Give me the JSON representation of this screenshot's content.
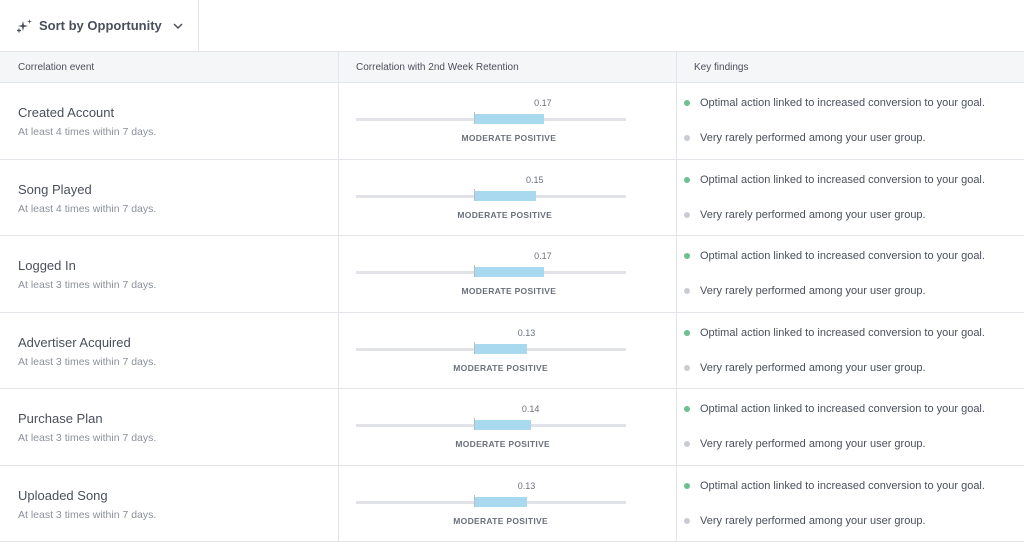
{
  "toolbar": {
    "sort_label": "Sort by Opportunity"
  },
  "table": {
    "headers": {
      "event": "Correlation event",
      "correlation": "Correlation with 2nd Week Retention",
      "findings": "Key findings"
    },
    "rows": [
      {
        "name": "Created Account",
        "subtitle": "At least 4 times within 7 days.",
        "value": 0.17,
        "value_label": "0.17",
        "category": "MODERATE POSITIVE",
        "findings": [
          {
            "text": "Optimal action linked to increased conversion to your goal.",
            "color": "#6cc08f"
          },
          {
            "text": "Very rarely performed among your user group.",
            "color": "#c9ccd2"
          }
        ]
      },
      {
        "name": "Song Played",
        "subtitle": "At least 4 times within 7 days.",
        "value": 0.15,
        "value_label": "0.15",
        "category": "MODERATE POSITIVE",
        "findings": [
          {
            "text": "Optimal action linked to increased conversion to your goal.",
            "color": "#6cc08f"
          },
          {
            "text": "Very rarely performed among your user group.",
            "color": "#c9ccd2"
          }
        ]
      },
      {
        "name": "Logged In",
        "subtitle": "At least 3 times within 7 days.",
        "value": 0.17,
        "value_label": "0.17",
        "category": "MODERATE POSITIVE",
        "findings": [
          {
            "text": "Optimal action linked to increased conversion to your goal.",
            "color": "#6cc08f"
          },
          {
            "text": "Very rarely performed among your user group.",
            "color": "#c9ccd2"
          }
        ]
      },
      {
        "name": "Advertiser Acquired",
        "subtitle": "At least 3 times within 7 days.",
        "value": 0.13,
        "value_label": "0.13",
        "category": "MODERATE POSITIVE",
        "findings": [
          {
            "text": "Optimal action linked to increased conversion to your goal.",
            "color": "#6cc08f"
          },
          {
            "text": "Very rarely performed among your user group.",
            "color": "#c9ccd2"
          }
        ]
      },
      {
        "name": "Purchase Plan",
        "subtitle": "At least 3 times within 7 days.",
        "value": 0.14,
        "value_label": "0.14",
        "category": "MODERATE POSITIVE",
        "findings": [
          {
            "text": "Optimal action linked to increased conversion to your goal.",
            "color": "#6cc08f"
          },
          {
            "text": "Very rarely performed among your user group.",
            "color": "#c9ccd2"
          }
        ]
      },
      {
        "name": "Uploaded Song",
        "subtitle": "At least 3 times within 7 days.",
        "value": 0.13,
        "value_label": "0.13",
        "category": "MODERATE POSITIVE",
        "findings": [
          {
            "text": "Optimal action linked to increased conversion to your goal.",
            "color": "#6cc08f"
          },
          {
            "text": "Very rarely performed among your user group.",
            "color": "#c9ccd2"
          }
        ]
      }
    ]
  },
  "icons": {
    "sort": "sparkle-icon",
    "dropdown": "chevron-down-icon"
  }
}
